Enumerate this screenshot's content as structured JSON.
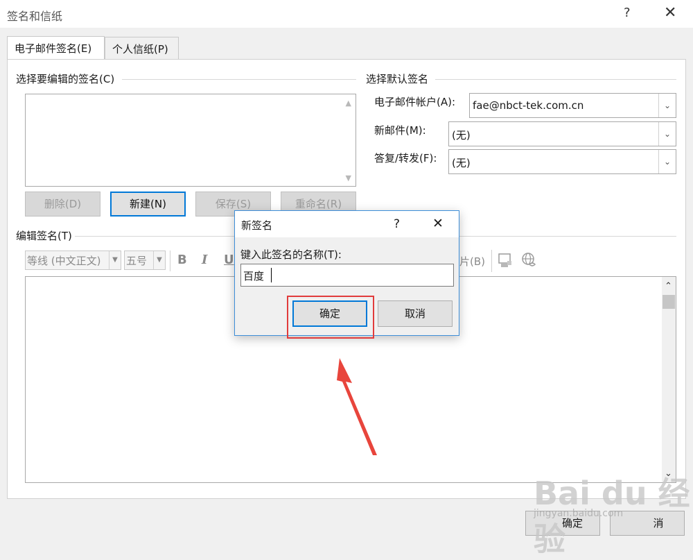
{
  "window": {
    "title": "签名和信纸",
    "help": "?",
    "close": "✕"
  },
  "tabs": [
    {
      "label": "电子邮件签名(E)"
    },
    {
      "label": "个人信纸(P)"
    }
  ],
  "signature_select": {
    "label": "选择要编辑的签名(C)",
    "buttons": {
      "delete": "删除(D)",
      "new": "新建(N)",
      "save": "保存(S)",
      "rename": "重命名(R)"
    }
  },
  "defaults": {
    "label": "选择默认签名",
    "account_label": "电子邮件帐户(A):",
    "account_value": "fae@nbct-tek.com.cn",
    "new_mail_label": "新邮件(M):",
    "new_mail_value": "(无)",
    "reply_label": "答复/转发(F):",
    "reply_value": "(无)"
  },
  "editor": {
    "label": "编辑签名(T)",
    "font_value": "等线 (中文正文)",
    "size_value": "五号",
    "bold": "B",
    "italic": "I",
    "underline": "U",
    "business_card_partial": "片(B)"
  },
  "modal": {
    "title": "新签名",
    "help": "?",
    "close": "✕",
    "prompt": "键入此签名的名称(T):",
    "input_value": "百度",
    "ok": "确定",
    "cancel": "取消"
  },
  "footer": {
    "ok_partial": "确定",
    "cancel_partial": "消"
  },
  "watermark": {
    "logo": "Bai du 经验",
    "url": "jingyan.baidu.com"
  },
  "colors": {
    "accent": "#0078d7",
    "highlight": "#e13b3b",
    "arrow": "#e8453c"
  }
}
